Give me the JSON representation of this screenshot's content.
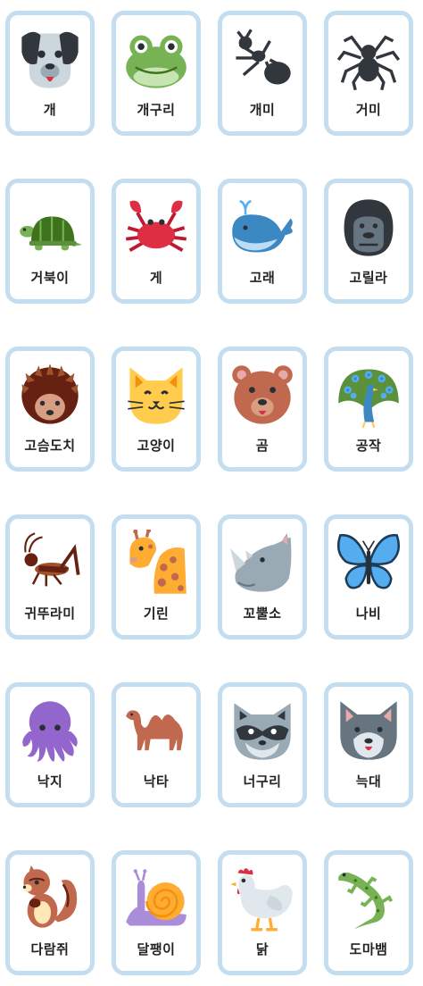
{
  "cards": [
    {
      "label": "개",
      "icon": "dog-face-icon"
    },
    {
      "label": "개구리",
      "icon": "frog-face-icon"
    },
    {
      "label": "개미",
      "icon": "ant-icon"
    },
    {
      "label": "거미",
      "icon": "spider-icon"
    },
    {
      "label": "거북이",
      "icon": "turtle-icon"
    },
    {
      "label": "게",
      "icon": "crab-icon"
    },
    {
      "label": "고래",
      "icon": "whale-icon"
    },
    {
      "label": "고릴라",
      "icon": "gorilla-icon"
    },
    {
      "label": "고슴도치",
      "icon": "hedgehog-icon"
    },
    {
      "label": "고양이",
      "icon": "cat-face-icon"
    },
    {
      "label": "곰",
      "icon": "bear-face-icon"
    },
    {
      "label": "공작",
      "icon": "peacock-icon"
    },
    {
      "label": "귀뚜라미",
      "icon": "cricket-icon"
    },
    {
      "label": "기린",
      "icon": "giraffe-icon"
    },
    {
      "label": "꼬뿔소",
      "icon": "rhinoceros-icon"
    },
    {
      "label": "나비",
      "icon": "butterfly-icon"
    },
    {
      "label": "낙지",
      "icon": "octopus-icon"
    },
    {
      "label": "낙타",
      "icon": "camel-icon"
    },
    {
      "label": "너구리",
      "icon": "raccoon-icon"
    },
    {
      "label": "늑대",
      "icon": "wolf-face-icon"
    },
    {
      "label": "다람쥐",
      "icon": "chipmunk-icon"
    },
    {
      "label": "달팽이",
      "icon": "snail-icon"
    },
    {
      "label": "닭",
      "icon": "chicken-icon"
    },
    {
      "label": "도마뱀",
      "icon": "lizard-icon"
    }
  ],
  "colors": {
    "card_border": "#c3ddf1",
    "label": "#222222"
  }
}
